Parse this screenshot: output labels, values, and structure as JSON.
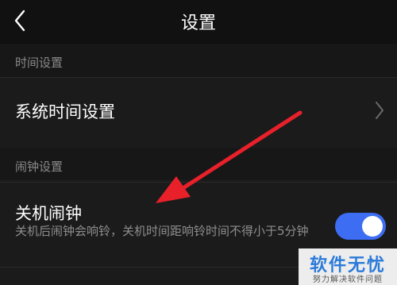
{
  "header": {
    "title": "设置",
    "back_icon": "chevron-left-icon"
  },
  "sections": [
    {
      "header": "时间设置",
      "items": [
        {
          "title": "系统时间设置",
          "icon": "chevron-right-icon"
        }
      ]
    },
    {
      "header": "闹钟设置",
      "items": [
        {
          "title": "关机闹钟",
          "description": "关机后闹钟会响铃，关机时间距响铃时间不得小于5分钟",
          "toggle_on": true
        }
      ]
    }
  ],
  "colors": {
    "background": "#1b1b1b",
    "toggle_accent": "#3d6df2",
    "annotation_arrow": "#e8202a"
  },
  "watermark": {
    "logo": "软件无忧",
    "subtitle": "努力解决软件问题"
  }
}
